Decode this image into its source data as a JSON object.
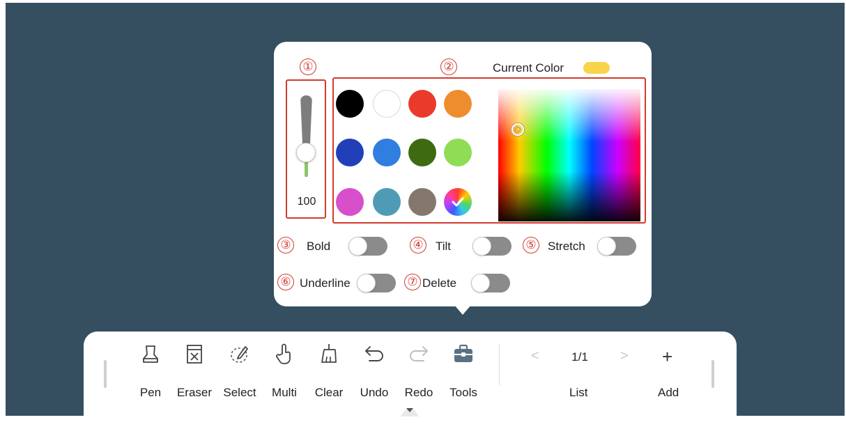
{
  "popup": {
    "current_color_label": "Current Color",
    "current_color": "#f8d44a",
    "callouts": [
      "①",
      "②",
      "③",
      "④",
      "⑤",
      "⑥",
      "⑦"
    ],
    "thickness_value": "100",
    "swatches": [
      {
        "name": "black",
        "color": "#000000"
      },
      {
        "name": "white",
        "color": "#ffffff"
      },
      {
        "name": "red",
        "color": "#ea3a2c"
      },
      {
        "name": "orange",
        "color": "#ee8d2d"
      },
      {
        "name": "navy",
        "color": "#2140b8"
      },
      {
        "name": "blue",
        "color": "#2f7ee0"
      },
      {
        "name": "dark-green",
        "color": "#3e6b10"
      },
      {
        "name": "light-green",
        "color": "#8fdc55"
      },
      {
        "name": "magenta",
        "color": "#d84fcb"
      },
      {
        "name": "teal",
        "color": "#4f9bb6"
      },
      {
        "name": "taupe",
        "color": "#84786c"
      },
      {
        "name": "custom",
        "color": "rainbow"
      }
    ],
    "options": {
      "bold": "Bold",
      "tilt": "Tilt",
      "stretch": "Stretch",
      "underline": "Underline",
      "delete": "Delete"
    }
  },
  "toolbar": {
    "tools": [
      "Pen",
      "Eraser",
      "Select",
      "Multi",
      "Clear",
      "Undo",
      "Redo",
      "Tools"
    ],
    "page_indicator": "1/1",
    "list_label": "List",
    "add_label": "Add",
    "add_symbol": "+",
    "prev_symbol": "<",
    "next_symbol": ">"
  },
  "colors": {
    "background": "#354f61",
    "callout_red": "#d13a2f",
    "toggle_off": "#8b8b8b"
  }
}
